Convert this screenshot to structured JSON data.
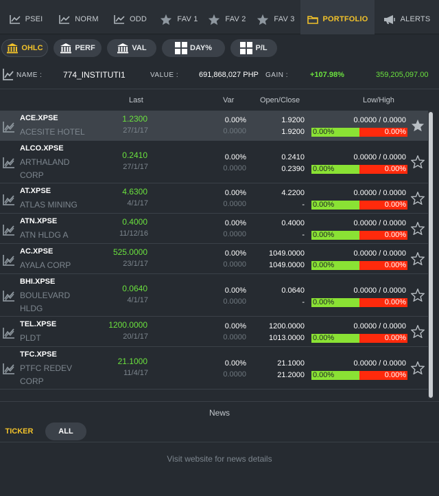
{
  "tabs": [
    {
      "label": "PSEI",
      "icon": "line-chart-icon"
    },
    {
      "label": "NORM",
      "icon": "line-chart-icon"
    },
    {
      "label": "ODD",
      "icon": "line-chart-icon"
    },
    {
      "label": "FAV 1",
      "icon": "star-icon"
    },
    {
      "label": "FAV 2",
      "icon": "star-icon"
    },
    {
      "label": "FAV 3",
      "icon": "star-icon"
    },
    {
      "label": "PORTFOLIO",
      "icon": "folder-icon",
      "active": true
    },
    {
      "label": "ALERTS",
      "icon": "megaphone-icon"
    }
  ],
  "subbar": {
    "ohlc": "OHLC",
    "perf": "PERF",
    "val": "VAL",
    "day": "DAY%",
    "pl": "P/L"
  },
  "account": {
    "name_label": "NAME :",
    "name": "774_INSTITUTI1",
    "value_label": "VALUE :",
    "value": "691,868,027 PHP",
    "gain_label": "GAIN :",
    "gain_pct": "+107.98%",
    "gain_amount": "359,205,097.00"
  },
  "columns": {
    "last": "Last",
    "var": "Var",
    "openclose": "Open/Close",
    "lowhigh": "Low/High"
  },
  "rows": [
    {
      "symbol": "ACE.XPSE",
      "name_lines": [
        "ACESITE HOTEL"
      ],
      "last": "1.2300",
      "date": "27/1/17",
      "var": "0.00%",
      "var_abs": "0.0000",
      "open": "1.9200",
      "close": "1.9200",
      "lowhigh": "0.0000 / 0.0000",
      "pct_low": "0.00%",
      "pct_high": "0.00%",
      "selected": true
    },
    {
      "symbol": "ALCO.XPSE",
      "name_lines": [
        "ARTHALAND",
        "CORP"
      ],
      "last": "0.2410",
      "date": "27/1/17",
      "var": "0.00%",
      "var_abs": "0.0000",
      "open": "0.2410",
      "close": "0.2390",
      "lowhigh": "0.0000 / 0.0000",
      "pct_low": "0.00%",
      "pct_high": "0.00%"
    },
    {
      "symbol": "AT.XPSE",
      "name_lines": [
        "ATLAS MINING"
      ],
      "last": "4.6300",
      "date": "4/1/17",
      "var": "0.00%",
      "var_abs": "0.0000",
      "open": "4.2200",
      "close": "-",
      "lowhigh": "0.0000 / 0.0000",
      "pct_low": "0.00%",
      "pct_high": "0.00%"
    },
    {
      "symbol": "ATN.XPSE",
      "name_lines": [
        "ATN HLDG A"
      ],
      "last": "0.4000",
      "date": "11/12/16",
      "var": "0.00%",
      "var_abs": "0.0000",
      "open": "0.4000",
      "close": "-",
      "lowhigh": "0.0000 / 0.0000",
      "pct_low": "0.00%",
      "pct_high": "0.00%"
    },
    {
      "symbol": "AC.XPSE",
      "name_lines": [
        "AYALA CORP"
      ],
      "last": "525.0000",
      "date": "23/1/17",
      "var": "0.00%",
      "var_abs": "0.0000",
      "open": "1049.0000",
      "close": "1049.0000",
      "lowhigh": "0.0000 / 0.0000",
      "pct_low": "0.00%",
      "pct_high": "0.00%"
    },
    {
      "symbol": "BHI.XPSE",
      "name_lines": [
        "BOULEVARD",
        "HLDG"
      ],
      "last": "0.0640",
      "date": "4/1/17",
      "var": "0.00%",
      "var_abs": "0.0000",
      "open": "0.0640",
      "close": "-",
      "lowhigh": "0.0000 / 0.0000",
      "pct_low": "0.00%",
      "pct_high": "0.00%"
    },
    {
      "symbol": "TEL.XPSE",
      "name_lines": [
        "PLDT"
      ],
      "last": "1200.0000",
      "date": "20/1/17",
      "var": "0.00%",
      "var_abs": "0.0000",
      "open": "1200.0000",
      "close": "1013.0000",
      "lowhigh": "0.0000 / 0.0000",
      "pct_low": "0.00%",
      "pct_high": "0.00%"
    },
    {
      "symbol": "TFC.XPSE",
      "name_lines": [
        "PTFC REDEV",
        "CORP"
      ],
      "last": "21.1000",
      "date": "11/4/17",
      "var": "0.00%",
      "var_abs": "0.0000",
      "open": "21.1000",
      "close": "21.2000",
      "lowhigh": "0.0000 / 0.0000",
      "pct_low": "0.00%",
      "pct_high": "0.00%"
    }
  ],
  "news": {
    "title": "News",
    "tab_ticker": "TICKER",
    "tab_all": "ALL",
    "message": "Visit website for news details"
  },
  "colors": {
    "accent": "#f2c22a",
    "gain": "#6be23e",
    "bar_green": "#8ae234",
    "bar_red": "#ff2a0c"
  }
}
